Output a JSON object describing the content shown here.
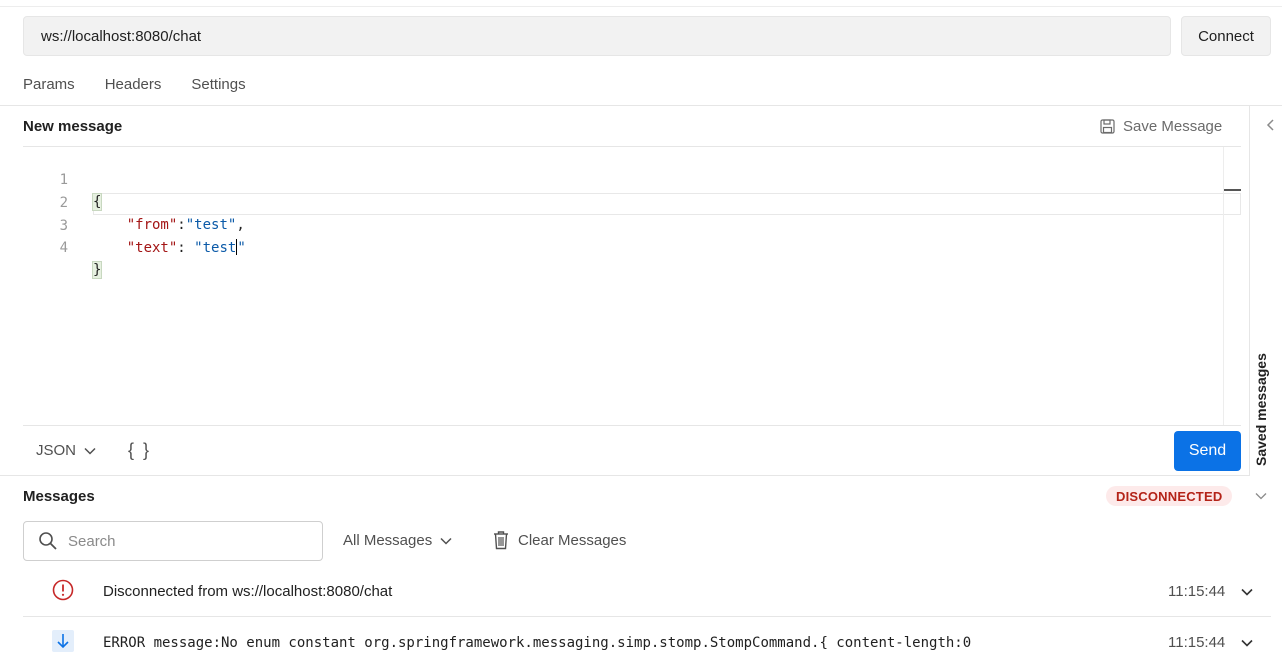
{
  "request": {
    "url": "ws://localhost:8080/chat",
    "connect_label": "Connect"
  },
  "tabs": [
    {
      "label": "Params"
    },
    {
      "label": "Headers"
    },
    {
      "label": "Settings"
    }
  ],
  "composer": {
    "title": "New message",
    "save_label": "Save Message",
    "saved_panel_label": "Saved messages",
    "line_numbers": [
      "1",
      "2",
      "3",
      "4"
    ],
    "format": "JSON",
    "beautify_label": "{ }",
    "send_label": "Send"
  },
  "messages": {
    "title": "Messages",
    "status": "DISCONNECTED",
    "search_placeholder": "Search",
    "filter": "All Messages",
    "clear_label": "Clear Messages",
    "items": [
      {
        "text": "Disconnected from ws://localhost:8080/chat",
        "time": "11:15:44",
        "icon": "error-circle-icon"
      },
      {
        "text": "ERROR message:No enum constant org.springframework.messaging.simp.stomp.StompCommand.{ content-length:0",
        "time": "11:15:44",
        "icon": "arrow-down-icon"
      }
    ]
  },
  "colors": {
    "accent": "#0b72e6",
    "status_bg": "#fdeaea",
    "status_text": "#b42318",
    "error_icon": "#c62828",
    "json_key": "#a31515",
    "json_string": "#0b5aa8"
  }
}
